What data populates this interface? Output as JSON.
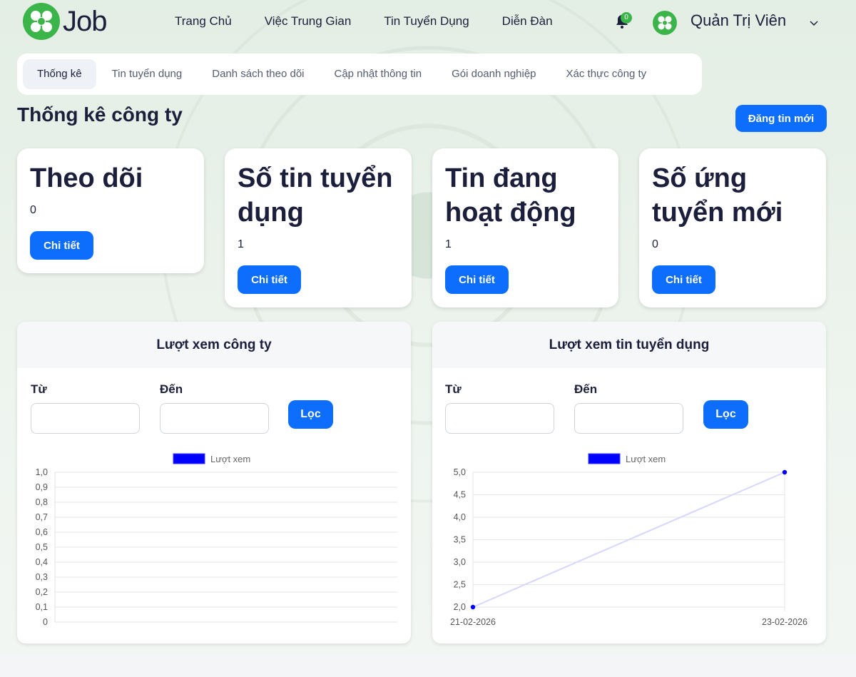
{
  "header": {
    "logo_text": "Job",
    "nav": [
      "Trang Chủ",
      "Việc Trung Gian",
      "Tin Tuyển Dụng",
      "Diễn Đàn"
    ],
    "notification_count": "0",
    "user_name": "Quản Trị Viên"
  },
  "tabs": [
    "Thống kê",
    "Tin tuyển dụng",
    "Danh sách theo dõi",
    "Cập nhật thông tin",
    "Gói doanh nghiệp",
    "Xác thực công ty"
  ],
  "page_title": "Thống kê công ty",
  "new_post_label": "Đăng tin mới",
  "stats": [
    {
      "title": "Theo dõi",
      "value": "0",
      "button": "Chi tiết"
    },
    {
      "title": "Số tin tuyển dụng",
      "value": "1",
      "button": "Chi tiết"
    },
    {
      "title": "Tin đang hoạt động",
      "value": "1",
      "button": "Chi tiết"
    },
    {
      "title": "Số ứng tuyển mới",
      "value": "0",
      "button": "Chi tiết"
    }
  ],
  "panels": [
    {
      "title": "Lượt xem công ty",
      "from_label": "Từ",
      "to_label": "Đến",
      "filter_label": "Lọc"
    },
    {
      "title": "Lượt xem tin tuyển dụng",
      "from_label": "Từ",
      "to_label": "Đến",
      "filter_label": "Lọc"
    }
  ],
  "colors": {
    "accent": "#0d6efd",
    "brand": "#3bb54a",
    "series": "#0000ff"
  },
  "chart_data": [
    {
      "type": "line",
      "legend": "Lượt xem",
      "x": [],
      "y": [],
      "yticks": [
        "1,0",
        "0,9",
        "0,8",
        "0,7",
        "0,6",
        "0,5",
        "0,4",
        "0,3",
        "0,2",
        "0,1",
        "0"
      ],
      "ylim": [
        0,
        1
      ],
      "xticks": [],
      "grid": true
    },
    {
      "type": "line",
      "legend": "Lượt xem",
      "x": [
        "21-02-2026",
        "23-02-2026"
      ],
      "y": [
        2,
        5
      ],
      "yticks": [
        "5,0",
        "4,5",
        "4,0",
        "3,5",
        "3,0",
        "2,5",
        "2,0"
      ],
      "ylim": [
        2,
        5
      ],
      "xticks": [
        "21-02-2026",
        "23-02-2026"
      ],
      "grid": true
    }
  ]
}
